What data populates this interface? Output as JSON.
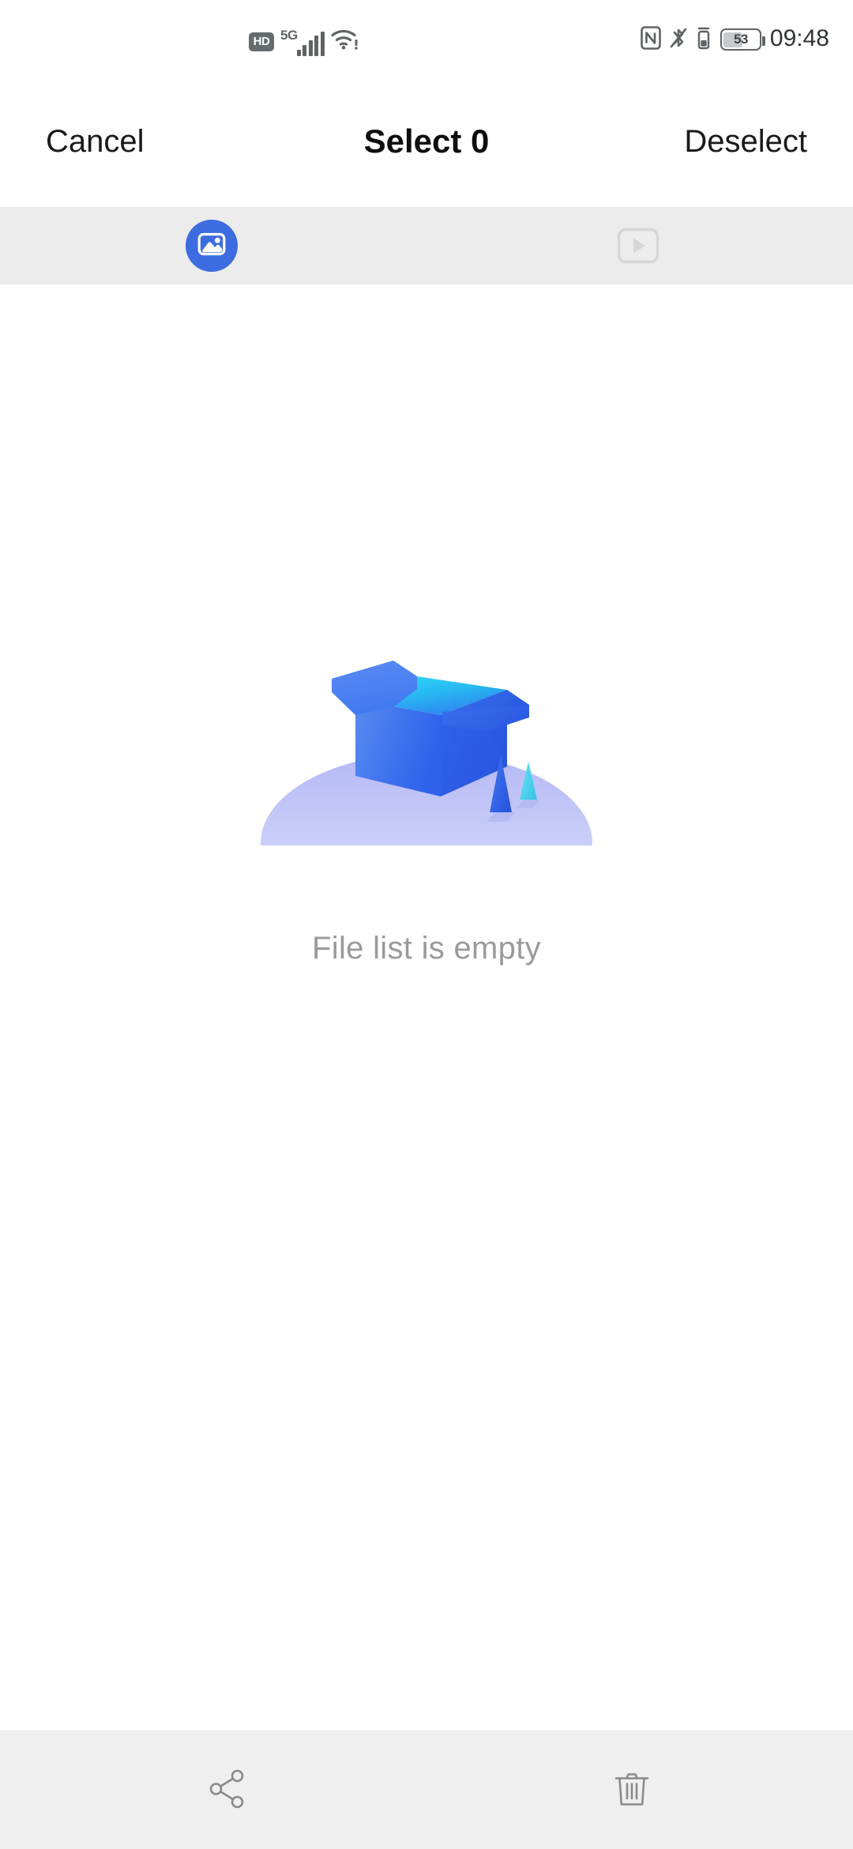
{
  "status_bar": {
    "hd_label": "HD",
    "network_label": "5G",
    "signal_icon": "signal-bars-icon",
    "wifi_icon": "wifi-icon",
    "nfc_icon": "nfc-icon",
    "bluetooth_icon": "bluetooth-off-icon",
    "vibrate_icon": "vibrate-icon",
    "battery_level": "53",
    "battery_icon": "battery-icon",
    "time": "09:48"
  },
  "header": {
    "cancel_label": "Cancel",
    "title": "Select 0",
    "deselect_label": "Deselect"
  },
  "tabs": [
    {
      "name": "photos",
      "icon": "image-icon",
      "active": true,
      "accent": "#3d6ce0"
    },
    {
      "name": "videos",
      "icon": "video-play-icon",
      "active": false,
      "accent": "#d4d4d4"
    }
  ],
  "content": {
    "illustration": "empty-box-illustration",
    "empty_message": "File list is empty"
  },
  "bottom_bar": {
    "share_icon": "share-icon",
    "delete_icon": "trash-icon"
  },
  "colors": {
    "accent_blue": "#3d6ce0",
    "tabbar_bg": "#ececec",
    "bottombar_bg": "#efefef",
    "empty_text": "#9a9a9e",
    "icon_gray": "#8a8a8a"
  }
}
